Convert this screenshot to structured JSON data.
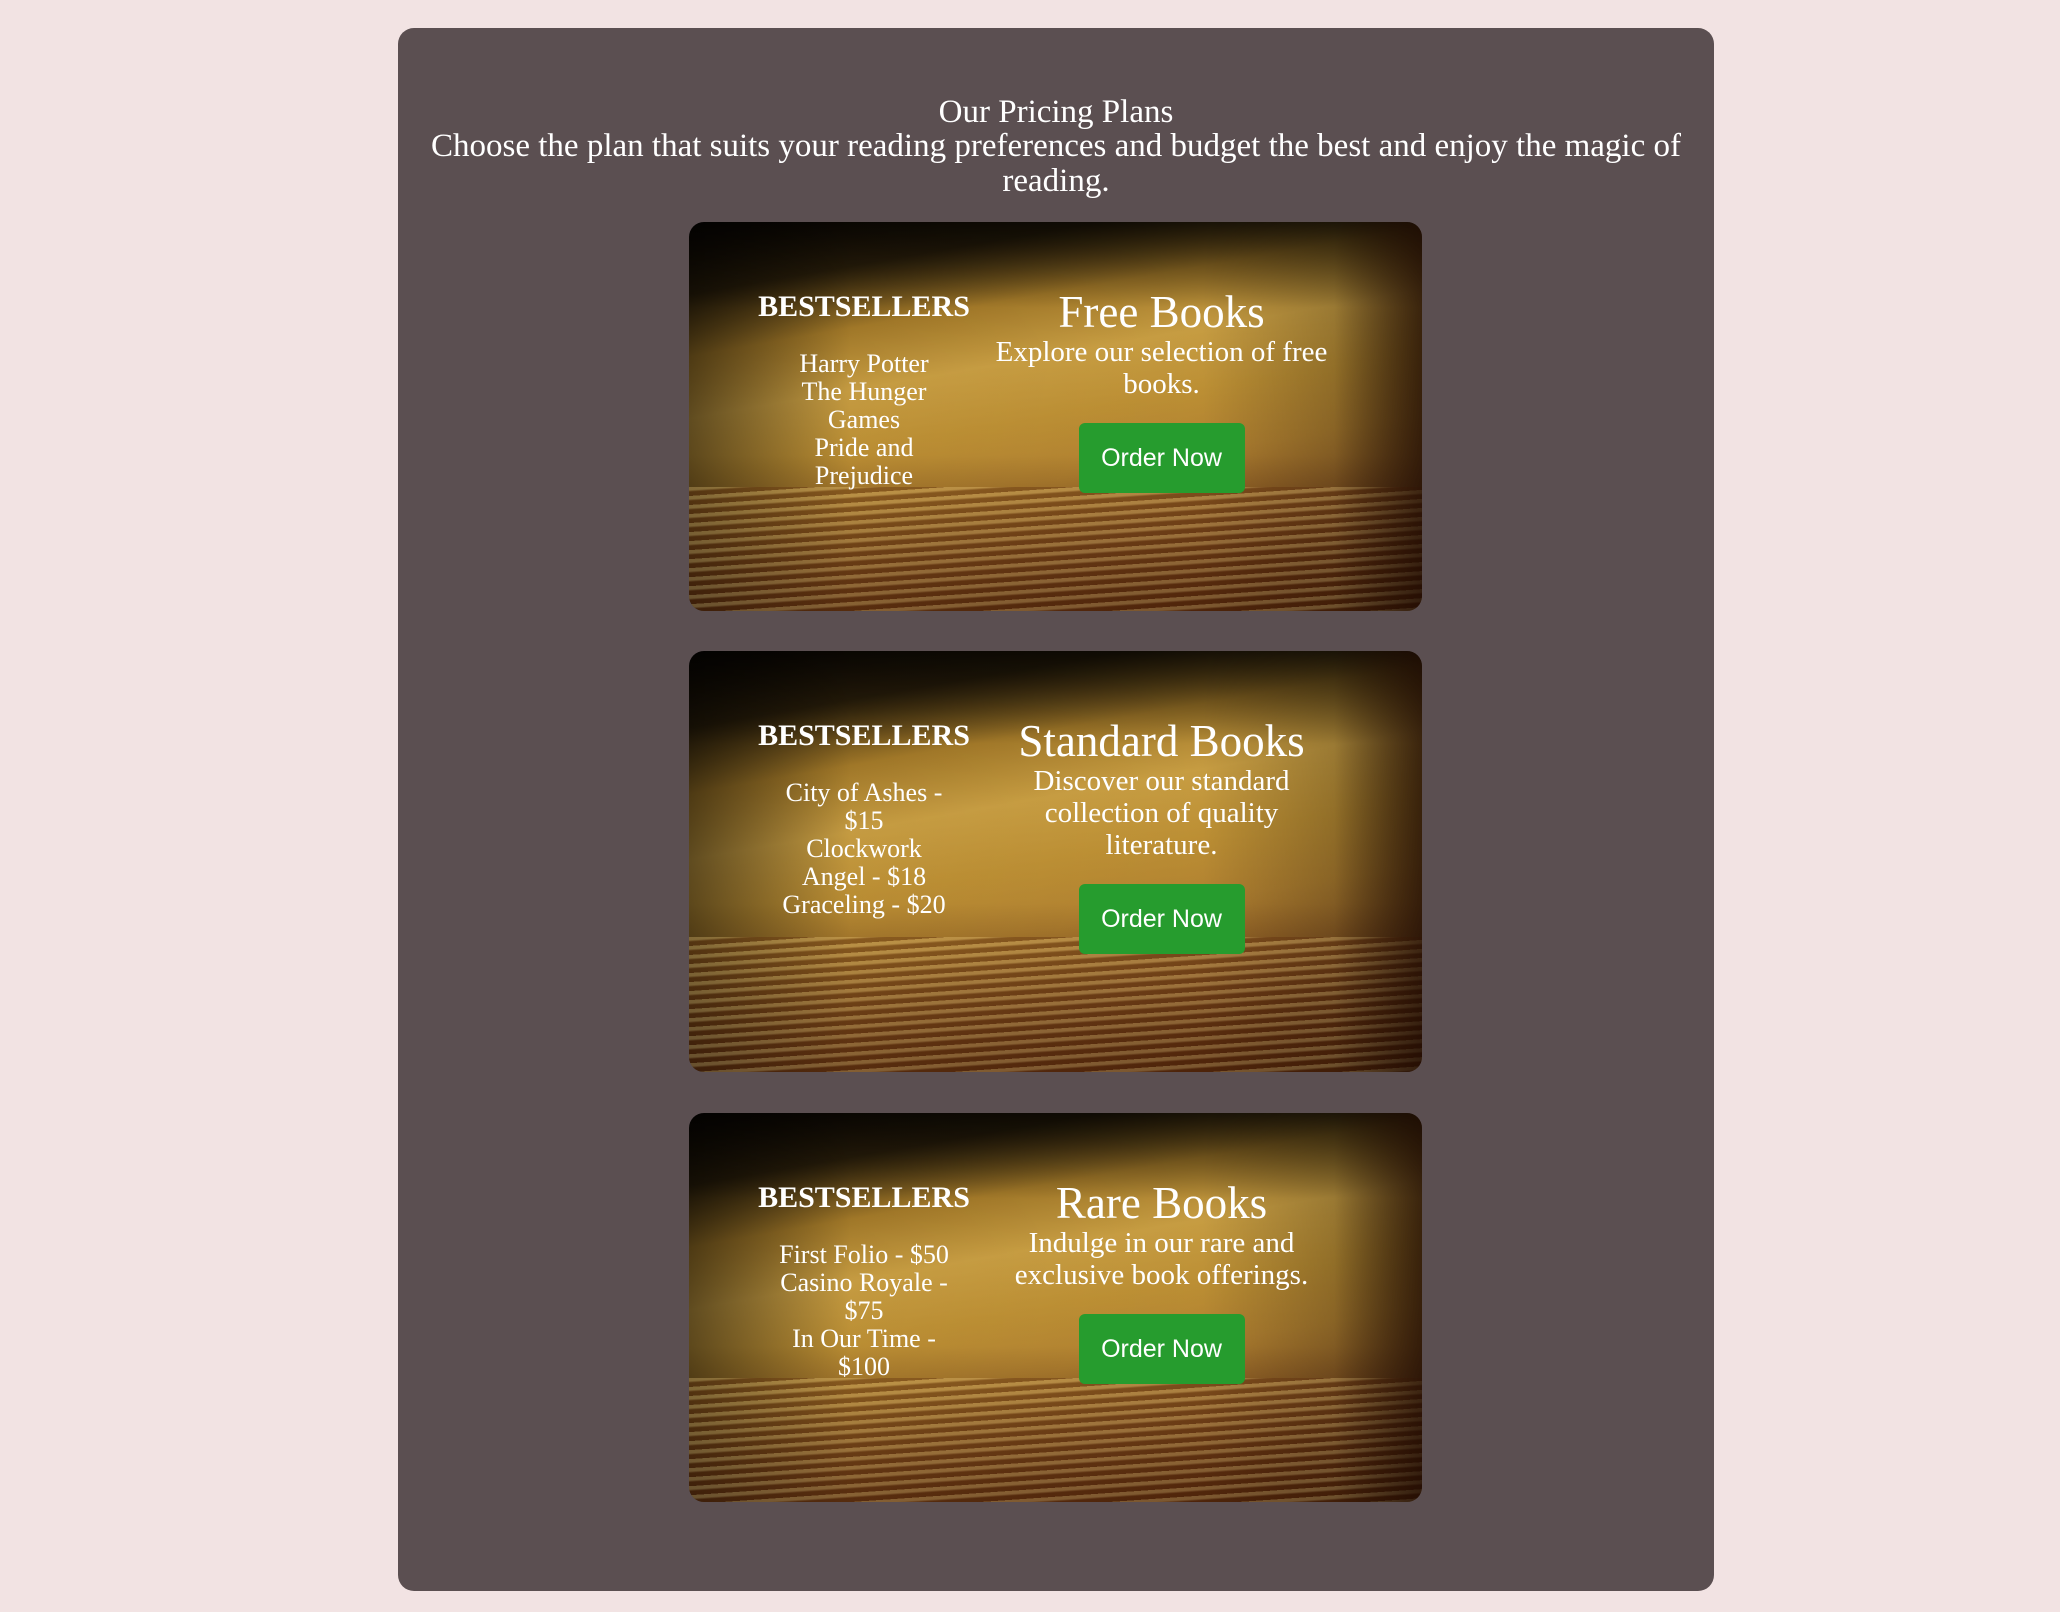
{
  "header": {
    "title": "Our Pricing Plans",
    "subtitle": "Choose the plan that suits your reading preferences and budget the best and enjoy the magic of reading."
  },
  "plans": [
    {
      "bestsellers_title": "BESTSELLERS",
      "bestsellers": [
        "Harry Potter",
        "The Hunger Games",
        "Pride and Prejudice"
      ],
      "name": "Free Books",
      "description": "Explore our selection of free books.",
      "button_label": "Order Now"
    },
    {
      "bestsellers_title": "BESTSELLERS",
      "bestsellers": [
        "City of Ashes - $15",
        "Clockwork Angel - $18",
        "Graceling - $20"
      ],
      "name": "Standard Books",
      "description": "Discover our standard collection of quality literature.",
      "button_label": "Order Now"
    },
    {
      "bestsellers_title": "BESTSELLERS",
      "bestsellers": [
        "First Folio - $50",
        "Casino Royale - $75",
        "In Our Time - $100"
      ],
      "name": "Rare Books",
      "description": "Indulge in our rare and exclusive book offerings.",
      "button_label": "Order Now"
    }
  ],
  "colors": {
    "page_background": "#f2e3e3",
    "panel_background": "#5b4f51",
    "button_background": "#269c2e",
    "text": "#ffffff"
  }
}
